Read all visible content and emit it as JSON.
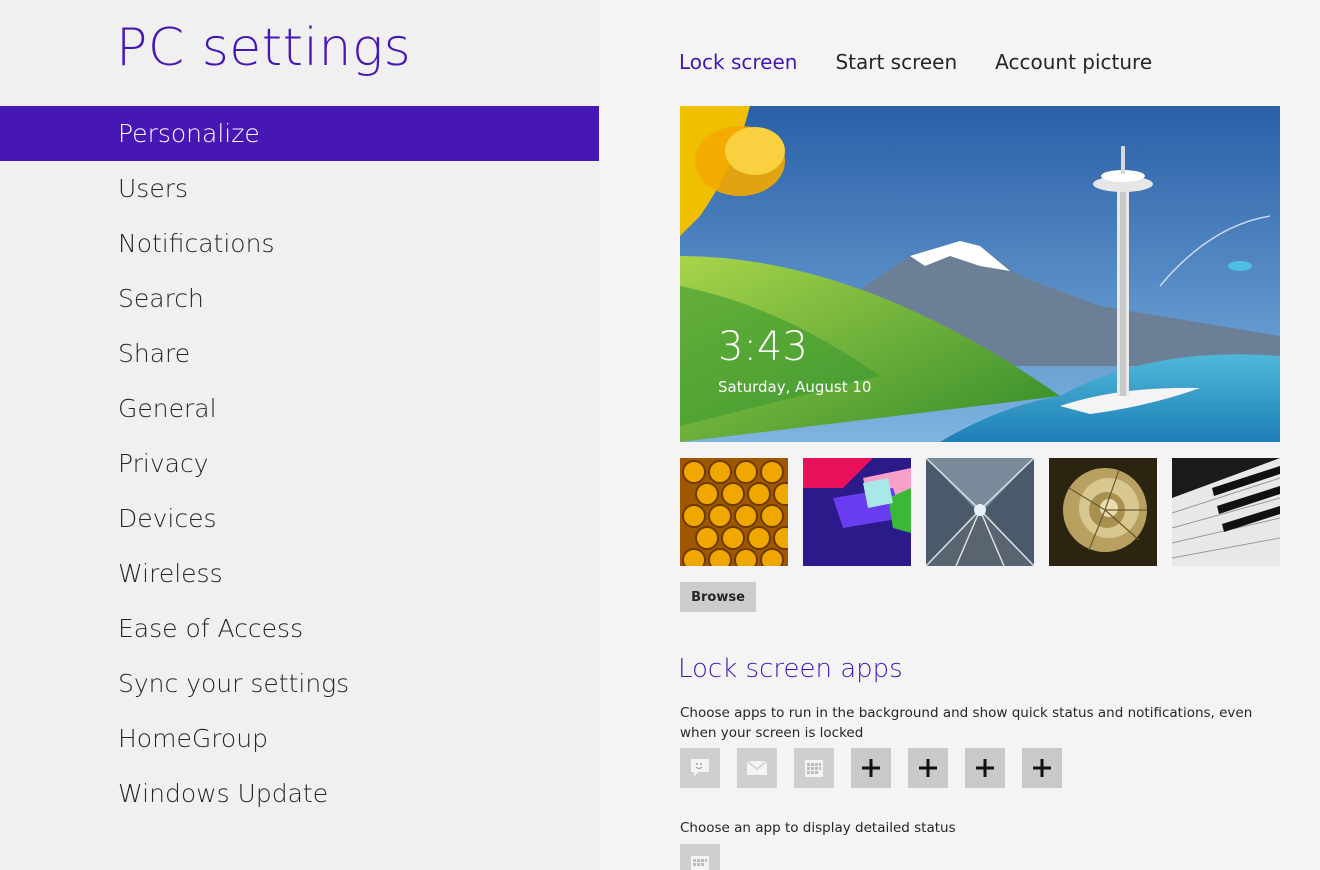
{
  "app": {
    "title": "PC settings"
  },
  "nav": {
    "items": [
      {
        "label": "Personalize",
        "selected": true
      },
      {
        "label": "Users"
      },
      {
        "label": "Notifications"
      },
      {
        "label": "Search"
      },
      {
        "label": "Share"
      },
      {
        "label": "General"
      },
      {
        "label": "Privacy"
      },
      {
        "label": "Devices"
      },
      {
        "label": "Wireless"
      },
      {
        "label": "Ease of Access"
      },
      {
        "label": "Sync your settings"
      },
      {
        "label": "HomeGroup"
      },
      {
        "label": "Windows Update"
      }
    ]
  },
  "tabs": [
    {
      "label": "Lock screen",
      "active": true
    },
    {
      "label": "Start screen"
    },
    {
      "label": "Account picture"
    }
  ],
  "preview": {
    "time": "3:43",
    "date": "Saturday, August 10"
  },
  "thumbnails": [
    "honeycomb",
    "geometric-shapes",
    "tunnel-lights",
    "nautilus-shell",
    "piano-keys"
  ],
  "browse_label": "Browse",
  "lock_apps": {
    "title": "Lock screen apps",
    "description": "Choose apps to run in the background and show quick status and notifications, even when your screen is locked",
    "slots": [
      {
        "icon": "messaging-icon"
      },
      {
        "icon": "mail-icon"
      },
      {
        "icon": "calendar-icon"
      },
      {
        "icon": "plus-icon"
      },
      {
        "icon": "plus-icon"
      },
      {
        "icon": "plus-icon"
      },
      {
        "icon": "plus-icon"
      }
    ],
    "detailed_description": "Choose an app to display detailed status",
    "detailed_icon": "calendar-icon"
  },
  "colors": {
    "accent": "#4617b4",
    "pane_bg": "#f0f0f0"
  }
}
